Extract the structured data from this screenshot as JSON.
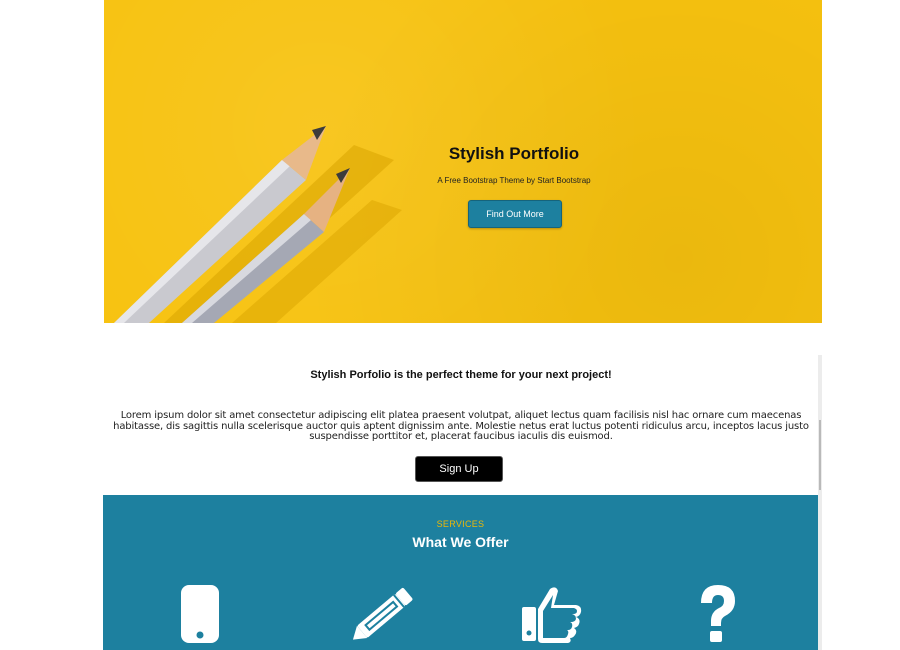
{
  "hero": {
    "title": "Stylish Portfolio",
    "subtitle": "A Free Bootstrap Theme by Start Bootstrap",
    "button_label": "Find Out More",
    "background_color": "#f7c20f",
    "button_color": "#1d809f"
  },
  "about": {
    "heading": "Stylish Porfolio is the perfect theme for your next project!",
    "body": "Lorem ipsum dolor sit amet consectetur adipiscing elit platea praesent volutpat, aliquet lectus quam facilisis nisl hac ornare cum maecenas habitasse, dis sagittis nulla scelerisque auctor quis aptent dignissim ante. Molestie netus erat luctus potenti ridiculus arcu, inceptos lacus justo suspendisse porttitor et, placerat faucibus iaculis dis euismod.",
    "button_label": "Sign Up"
  },
  "services": {
    "eyebrow": "SERVICES",
    "heading": "What We Offer",
    "background_color": "#1d809f",
    "eyebrow_color": "#ecb807",
    "icons": [
      "mobile-phone-icon",
      "pencil-icon",
      "thumbs-up-icon",
      "question-mark-icon"
    ]
  }
}
